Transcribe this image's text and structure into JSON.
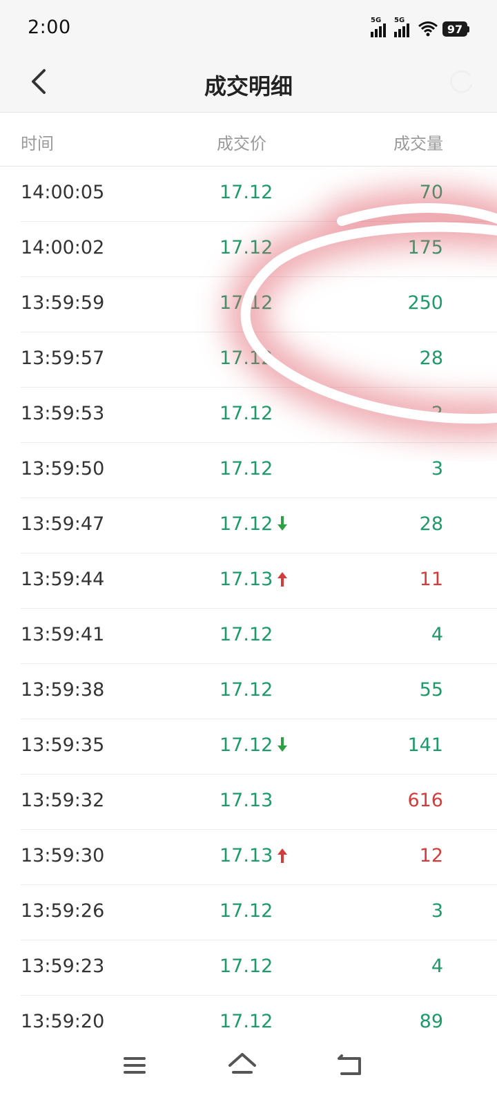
{
  "status": {
    "time": "2:00",
    "battery": "97",
    "sim1": "5G",
    "sim2": "5G"
  },
  "nav": {
    "title": "成交明细"
  },
  "columns": {
    "time": "时间",
    "price": "成交价",
    "volume": "成交量"
  },
  "colors": {
    "up": "#d63b3b",
    "down": "#1e9a6a",
    "arrow_down": "#2ea043",
    "arrow_up": "#d63b3b"
  },
  "rows": [
    {
      "time": "14:00:05",
      "price": "17.12",
      "volume": "70",
      "price_color": "green",
      "vol_color": "green",
      "arrow": ""
    },
    {
      "time": "14:00:02",
      "price": "17.12",
      "volume": "175",
      "price_color": "green",
      "vol_color": "green",
      "arrow": ""
    },
    {
      "time": "13:59:59",
      "price": "17.12",
      "volume": "250",
      "price_color": "green",
      "vol_color": "green",
      "arrow": ""
    },
    {
      "time": "13:59:57",
      "price": "17.12",
      "volume": "28",
      "price_color": "green",
      "vol_color": "green",
      "arrow": ""
    },
    {
      "time": "13:59:53",
      "price": "17.12",
      "volume": "2",
      "price_color": "green",
      "vol_color": "green",
      "arrow": ""
    },
    {
      "time": "13:59:50",
      "price": "17.12",
      "volume": "3",
      "price_color": "green",
      "vol_color": "green",
      "arrow": ""
    },
    {
      "time": "13:59:47",
      "price": "17.12",
      "volume": "28",
      "price_color": "green",
      "vol_color": "green",
      "arrow": "down"
    },
    {
      "time": "13:59:44",
      "price": "17.13",
      "volume": "11",
      "price_color": "green",
      "vol_color": "red",
      "arrow": "up"
    },
    {
      "time": "13:59:41",
      "price": "17.12",
      "volume": "4",
      "price_color": "green",
      "vol_color": "green",
      "arrow": ""
    },
    {
      "time": "13:59:38",
      "price": "17.12",
      "volume": "55",
      "price_color": "green",
      "vol_color": "green",
      "arrow": ""
    },
    {
      "time": "13:59:35",
      "price": "17.12",
      "volume": "141",
      "price_color": "green",
      "vol_color": "green",
      "arrow": "down"
    },
    {
      "time": "13:59:32",
      "price": "17.13",
      "volume": "616",
      "price_color": "green",
      "vol_color": "red",
      "arrow": ""
    },
    {
      "time": "13:59:30",
      "price": "17.13",
      "volume": "12",
      "price_color": "green",
      "vol_color": "red",
      "arrow": "up"
    },
    {
      "time": "13:59:26",
      "price": "17.12",
      "volume": "3",
      "price_color": "green",
      "vol_color": "green",
      "arrow": ""
    },
    {
      "time": "13:59:23",
      "price": "17.12",
      "volume": "4",
      "price_color": "green",
      "vol_color": "green",
      "arrow": ""
    },
    {
      "time": "13:59:20",
      "price": "17.12",
      "volume": "89",
      "price_color": "green",
      "vol_color": "green",
      "arrow": ""
    }
  ],
  "icons": {
    "back": "chevron-left-icon",
    "refresh": "refresh-icon",
    "menu": "menu-icon",
    "home": "home-icon",
    "return": "return-icon"
  }
}
